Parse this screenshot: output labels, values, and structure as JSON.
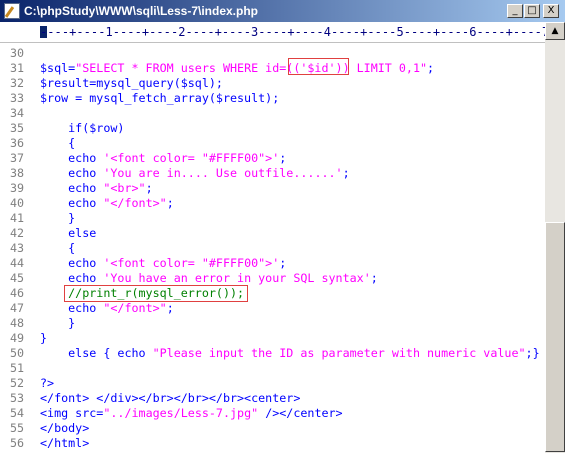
{
  "window": {
    "title": "C:\\phpStudy\\WWW\\sqli\\Less-7\\index.php",
    "minimize_label": "_",
    "maximize_label": "□",
    "close_label": "X"
  },
  "ruler": {
    "text": "----+----1----+----2----+----3----+----4----+----5----+----6----+----7---"
  },
  "lines": [
    {
      "num": "30",
      "code": ""
    },
    {
      "num": "31",
      "p1": "$sql=",
      "s1": "\"SELECT * FROM users WHERE id=(('$id')) LIMIT 0,1\"",
      "p2": ";"
    },
    {
      "num": "32",
      "code": "$result=mysql_query($sql);"
    },
    {
      "num": "33",
      "code": "$row = mysql_fetch_array($result);"
    },
    {
      "num": "34",
      "code": ""
    },
    {
      "num": "35",
      "code": "    if($row)"
    },
    {
      "num": "36",
      "code": "    {"
    },
    {
      "num": "37",
      "p1": "    echo ",
      "s1": "'<font color= \"#FFFF00\">'",
      "p2": ";"
    },
    {
      "num": "38",
      "p1": "    echo ",
      "s1": "'You are in.... Use outfile......'",
      "p2": ";"
    },
    {
      "num": "39",
      "p1": "    echo ",
      "s1": "\"<br>\"",
      "p2": ";"
    },
    {
      "num": "40",
      "p1": "    echo ",
      "s1": "\"</font>\"",
      "p2": ";"
    },
    {
      "num": "41",
      "code": "    }"
    },
    {
      "num": "42",
      "code": "    else"
    },
    {
      "num": "43",
      "code": "    {"
    },
    {
      "num": "44",
      "p1": "    echo ",
      "s1": "'<font color= \"#FFFF00\">'",
      "p2": ";"
    },
    {
      "num": "45",
      "p1": "    echo ",
      "s1": "'You have an error in your SQL syntax'",
      "p2": ";"
    },
    {
      "num": "46",
      "comment": "    //print_r(mysql_error());"
    },
    {
      "num": "47",
      "p1": "    echo ",
      "s1": "\"</font>\"",
      "p2": ";"
    },
    {
      "num": "48",
      "code": "    }"
    },
    {
      "num": "49",
      "code": "}"
    },
    {
      "num": "50",
      "p1": "    else { echo ",
      "s1": "\"Please input the ID as parameter with numeric value\"",
      "p2": ";}"
    },
    {
      "num": "51",
      "code": ""
    },
    {
      "num": "52",
      "code": "?>"
    },
    {
      "num": "53",
      "code": "</font> </div></br></br></br><center>"
    },
    {
      "num": "54",
      "p1": "<img src=",
      "s1": "\"../images/Less-7.jpg\"",
      "p2": " /></center>"
    },
    {
      "num": "55",
      "code": "</body>"
    },
    {
      "num": "56",
      "code": "</html>"
    }
  ],
  "colors": {
    "code": "#0000ff",
    "string": "#ff00ff",
    "comment": "#008000",
    "line_number": "#808080",
    "highlight_box": "#e04040"
  },
  "scrollbar": {
    "up_arrow": "▲"
  }
}
